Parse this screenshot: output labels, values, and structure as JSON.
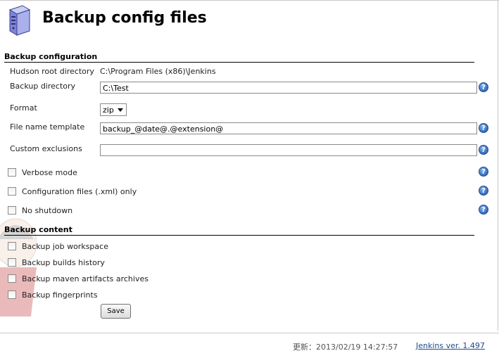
{
  "page": {
    "title": "Backup config files"
  },
  "sections": {
    "configuration": "Backup configuration",
    "content": "Backup content"
  },
  "fields": {
    "hudson_root": {
      "label": "Hudson root directory",
      "value": "C:\\Program Files (x86)\\Jenkins"
    },
    "backup_directory": {
      "label": "Backup directory",
      "value": "C:\\Test"
    },
    "format": {
      "label": "Format",
      "value": "zip"
    },
    "file_name_template": {
      "label": "File name template",
      "value": "backup_@date@.@extension@"
    },
    "custom_exclusions": {
      "label": "Custom exclusions",
      "value": ""
    }
  },
  "options": {
    "verbose_mode": {
      "label": "Verbose mode",
      "checked": false
    },
    "xml_only": {
      "label": "Configuration files (.xml) only",
      "checked": false
    },
    "no_shutdown": {
      "label": "No shutdown",
      "checked": false
    }
  },
  "content_options": {
    "job_workspace": {
      "label": "Backup job workspace",
      "checked": false
    },
    "builds_history": {
      "label": "Backup builds history",
      "checked": false
    },
    "maven_artifacts": {
      "label": "Backup maven artifacts archives",
      "checked": false
    },
    "fingerprints": {
      "label": "Backup fingerprints",
      "checked": false
    }
  },
  "help_glyph": "?",
  "save_label": "Save",
  "footer": {
    "updated": "更新：2013/02/19 14:27:57",
    "version_link": "Jenkins ver. 1.497"
  },
  "colors": {
    "help_icon": "#3d74c4",
    "link": "#204a87"
  }
}
